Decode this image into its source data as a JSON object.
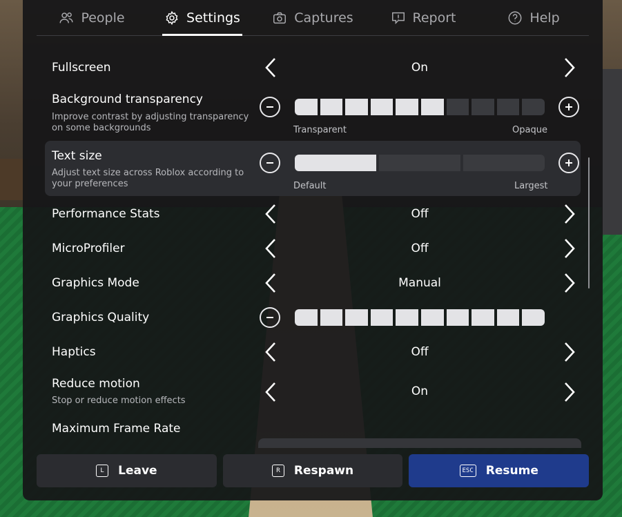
{
  "tabs": [
    {
      "label": "People",
      "icon": "people-icon",
      "active": false
    },
    {
      "label": "Settings",
      "icon": "gear-icon",
      "active": true
    },
    {
      "label": "Captures",
      "icon": "camera-icon",
      "active": false
    },
    {
      "label": "Report",
      "icon": "report-icon",
      "active": false
    },
    {
      "label": "Help",
      "icon": "help-icon",
      "active": false
    }
  ],
  "settings": {
    "fullscreen": {
      "label": "Fullscreen",
      "value": "On"
    },
    "background_transparency": {
      "label": "Background transparency",
      "description": "Improve contrast by adjusting transparency on some backgrounds",
      "min_label": "Transparent",
      "max_label": "Opaque",
      "level": 6,
      "steps": 10
    },
    "text_size": {
      "label": "Text size",
      "description": "Adjust text size across Roblox according to your preferences",
      "min_label": "Default",
      "max_label": "Largest",
      "level": 1,
      "steps": 3
    },
    "performance_stats": {
      "label": "Performance Stats",
      "value": "Off"
    },
    "microprofiler": {
      "label": "MicroProfiler",
      "value": "Off"
    },
    "graphics_mode": {
      "label": "Graphics Mode",
      "value": "Manual"
    },
    "graphics_quality": {
      "label": "Graphics Quality",
      "level": 10,
      "steps": 10
    },
    "haptics": {
      "label": "Haptics",
      "value": "Off"
    },
    "reduce_motion": {
      "label": "Reduce motion",
      "description": "Stop or reduce motion effects",
      "value": "On"
    },
    "max_frame_rate": {
      "label": "Maximum Frame Rate"
    }
  },
  "bottom_bar": {
    "leave": {
      "label": "Leave",
      "key": "L"
    },
    "respawn": {
      "label": "Respawn",
      "key": "R"
    },
    "resume": {
      "label": "Resume",
      "key": "ESC"
    }
  },
  "colors": {
    "panel_bg": "#161618",
    "slider_on": "#e3e3e6",
    "slider_off": "#3a3b3f",
    "resume_button": "#1f3b8c",
    "annotation_arrow": "#ff0d0d"
  }
}
